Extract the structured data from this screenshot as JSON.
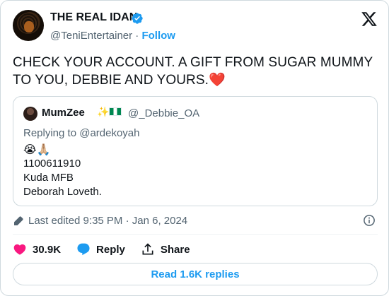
{
  "author": {
    "display_name": "THE REAL IDAN",
    "handle": "@TeniEntertainer",
    "separator": "·",
    "follow_label": "Follow"
  },
  "tweet": {
    "text": "CHECK YOUR ACCOUNT. A GIFT FROM SUGAR MUMMY TO YOU, DEBBIE AND YOURS.",
    "emoji": "❤️"
  },
  "quoted": {
    "name": "MumZee",
    "name_emojis": "✨",
    "handle": "@_Debbie_OA",
    "replying_to": "Replying to @ardekoyah",
    "emoji_line": "😭🙏🏼",
    "lines": [
      "1100611910",
      "Kuda MFB",
      "Deborah Loveth."
    ]
  },
  "meta": {
    "edited": "Last edited 9:35 PM · Jan 6, 2024"
  },
  "actions": {
    "likes": "30.9K",
    "reply_label": "Reply",
    "share_label": "Share"
  },
  "read_replies": "Read 1.6K replies",
  "colors": {
    "accent": "#1d9bf0",
    "like": "#f91880",
    "text": "#0f1419",
    "secondary": "#536471",
    "border": "#cfd9de"
  },
  "icons": [
    "verified-badge-icon",
    "x-logo-icon",
    "nigeria-flag-icon",
    "pencil-icon",
    "info-icon",
    "heart-icon",
    "reply-bubble-icon",
    "share-icon"
  ]
}
